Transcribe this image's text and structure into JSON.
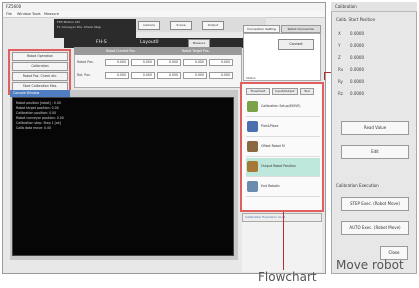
{
  "main_window": {
    "title": "FZ5600",
    "menu": [
      "File",
      "Window",
      "Tools",
      "Measure"
    ],
    "header": {
      "strip_lines": [
        "FZ5 Motion Ctrl",
        "F1 Conveyor  Pos. Check  Step"
      ],
      "scene": "FH-S",
      "layout": "Layout0",
      "label": "Measure",
      "btn_a": "Camera",
      "btn_b": "Scene",
      "btn_c": "Output"
    },
    "left_buttons": [
      "Robot Operation",
      "Calibration",
      "Robot Pos. Check etc.",
      "Start Calibration Mes."
    ],
    "param_table": {
      "headers": [
        "Robot Current Pos.",
        "",
        "Robot Target Pos."
      ],
      "rows": [
        {
          "label": "Robot Pos.",
          "values": [
            "0.000",
            "0.000",
            "0.000",
            "0.000",
            "0.000",
            "0.000"
          ]
        },
        {
          "label": "Rot. Pos.",
          "values": [
            "0.000",
            "0.000",
            "0.000",
            "0.000",
            "0.000",
            "0.000"
          ]
        }
      ]
    },
    "console": {
      "tab": "Console Window",
      "lines": [
        "Robot position [robot] : 0.00",
        "Robot target position: 0.00",
        "Calibration position: 0.00",
        "Robot conveyor position: 0.00",
        "Calibration step: Step 1 [ok]",
        "Calib data move: 0.00"
      ]
    }
  },
  "right_panel": {
    "tab_active": "Connection Setting",
    "tab_other": "Robot Connection",
    "connect_button": "Connect",
    "label": "Status",
    "flowchart": {
      "tabs": [
        "Flowchart",
        "Input/Output",
        "Tool"
      ],
      "steps": [
        {
          "label": "Calibration Setup(MOVE)",
          "icon": "gear-icon"
        },
        {
          "label": "Pick&Place",
          "icon": "pick-icon"
        },
        {
          "label": "Offset Robot M",
          "icon": "robot-icon"
        },
        {
          "label": "Output Robot Position",
          "icon": "output-icon"
        },
        {
          "label": "End Robotic",
          "icon": "end-icon"
        }
      ],
      "bottom_bar": "Calibration Execution Cont."
    }
  },
  "calibration_dialog": {
    "title": "Calibration",
    "section_title": "Calib. Start Position",
    "axes": [
      {
        "label": "X",
        "value": "0.0000"
      },
      {
        "label": "Y",
        "value": "0.0000"
      },
      {
        "label": "Z",
        "value": "0.0000"
      },
      {
        "label": "Rx",
        "value": "0.0000"
      },
      {
        "label": "Ry",
        "value": "0.0000"
      },
      {
        "label": "Rz",
        "value": "0.0000"
      }
    ],
    "read_button": "Read Value",
    "edit_button": "Edit",
    "exec_label": "Calibration Execution",
    "step_button": "STEP Exec. (Robot Move)",
    "auto_button": "AUTO Exec. (Robot Move)",
    "close_button": "Close"
  },
  "captions": {
    "flowchart": "Flowchart",
    "move_robot": "Move robot"
  }
}
